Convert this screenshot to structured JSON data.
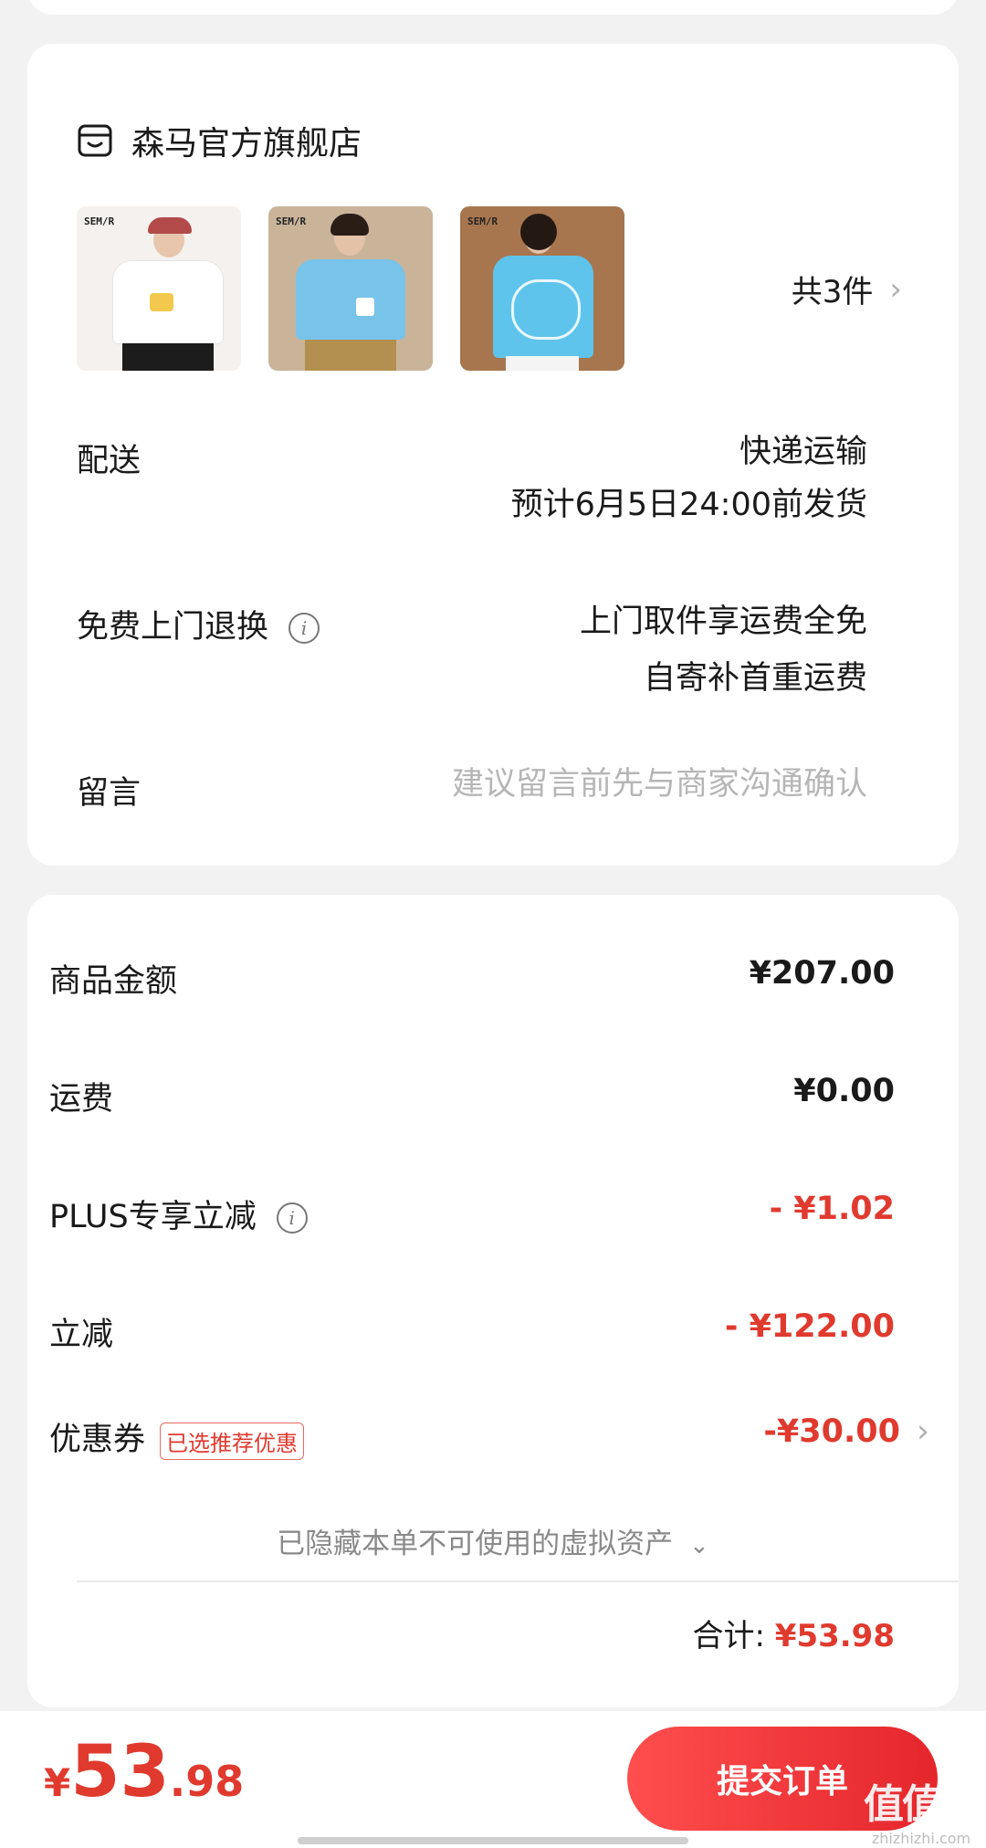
{
  "store": {
    "name": "森马官方旗舰店",
    "icon": "store-icon",
    "thumb_tag": "SEM/R",
    "count_label": "共3件"
  },
  "rows": {
    "delivery_label": "配送",
    "delivery_method": "快递运输",
    "delivery_eta": "预计6月5日24:00前发货",
    "return_label": "免费上门退换",
    "return_line1": "上门取件享运费全免",
    "return_line2": "自寄补首重运费",
    "note_label": "留言",
    "note_placeholder": "建议留言前先与商家沟通确认"
  },
  "prices": {
    "goods_label": "商品金额",
    "goods_value": "¥207.00",
    "shipping_label": "运费",
    "shipping_value": "¥0.00",
    "plus_label": "PLUS专享立减",
    "plus_value": "- ¥1.02",
    "discount_label": "立减",
    "discount_value": "- ¥122.00",
    "coupon_label": "优惠券",
    "coupon_badge": "已选推荐优惠",
    "coupon_value": "-¥30.00",
    "hidden_assets": "已隐藏本单不可使用的虚拟资产",
    "total_label": "合计:",
    "total_value": "¥53.98"
  },
  "bottom": {
    "currency": "¥",
    "price_int": "53",
    "price_dec": ".98",
    "submit_label": "提交订单"
  },
  "watermark": {
    "main": "值值值",
    "sub": "zhizhizhi.com"
  },
  "colors": {
    "accent_red": "#e03a2f",
    "background": "#f2f2f2"
  }
}
